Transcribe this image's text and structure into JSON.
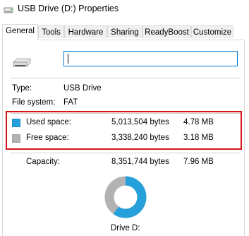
{
  "window": {
    "title": "USB Drive (D:) Properties",
    "icon": "drive-properties-icon"
  },
  "tabs": [
    {
      "label": "General",
      "active": true
    },
    {
      "label": "Tools",
      "active": false
    },
    {
      "label": "Hardware",
      "active": false
    },
    {
      "label": "Sharing",
      "active": false
    },
    {
      "label": "ReadyBoost",
      "active": false
    },
    {
      "label": "Customize",
      "active": false
    }
  ],
  "general": {
    "drive_icon": "usb-drive-icon",
    "name_value": "",
    "type_label": "Type:",
    "type_value": "USB Drive",
    "fs_label": "File system:",
    "fs_value": "FAT",
    "used": {
      "label": "Used space:",
      "bytes": "5,013,504 bytes",
      "size": "4.78 MB",
      "color": "#26a0da"
    },
    "free": {
      "label": "Free space:",
      "bytes": "3,338,240 bytes",
      "size": "3.18 MB",
      "color": "#b2b2b2"
    },
    "capacity": {
      "label": "Capacity:",
      "bytes": "8,351,744 bytes",
      "size": "7.96 MB"
    },
    "used_fraction": 0.6003,
    "drive_caption": "Drive D:"
  },
  "colors": {
    "highlight_border": "#d4161b",
    "input_focus": "#0078d7"
  }
}
